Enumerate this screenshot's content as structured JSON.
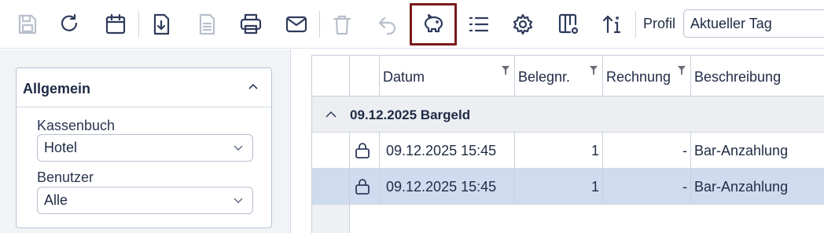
{
  "toolbar": {
    "buttons": [
      {
        "icon": "save-icon",
        "disabled": true
      },
      {
        "icon": "refresh-icon",
        "disabled": false
      },
      {
        "icon": "calendar-icon",
        "disabled": false
      },
      {
        "icon": "export-download-icon",
        "disabled": false
      },
      {
        "icon": "document-icon",
        "disabled": true
      },
      {
        "icon": "printer-icon",
        "disabled": false
      },
      {
        "icon": "mail-icon",
        "disabled": false
      },
      {
        "icon": "trash-icon",
        "disabled": true
      },
      {
        "icon": "undo-icon",
        "disabled": true
      },
      {
        "icon": "piggy-bank-icon",
        "disabled": false,
        "active": true
      },
      {
        "icon": "list-icon",
        "disabled": false
      },
      {
        "icon": "gear-icon",
        "disabled": false
      },
      {
        "icon": "column-settings-icon",
        "disabled": false
      },
      {
        "icon": "sort-info-icon",
        "disabled": false
      }
    ],
    "profil_label": "Profil",
    "profil_value": "Aktueller Tag"
  },
  "filters": {
    "title": "Allgemein",
    "kassenbuch_label": "Kassenbuch",
    "kassenbuch_value": "Hotel",
    "benutzer_label": "Benutzer",
    "benutzer_value": "Alle"
  },
  "grid": {
    "columns": [
      "",
      "",
      "Datum",
      "Belegnr.",
      "Rechnung",
      "Beschreibung"
    ],
    "group_label": "09.12.2025 Bargeld",
    "rows": [
      {
        "datum": "09.12.2025 15:45",
        "belegnr": "1",
        "rechnung": "-",
        "beschreibung": "Bar-Anzahlung",
        "locked": true,
        "selected": false
      },
      {
        "datum": "09.12.2025 15:45",
        "belegnr": "1",
        "rechnung": "-",
        "beschreibung": "Bar-Anzahlung",
        "locked": true,
        "selected": true
      }
    ]
  },
  "colors": {
    "accent_active_border": "#7a1a1a",
    "selected_row": "#cfdcef",
    "icon": "#2f3b5c",
    "icon_disabled": "#b9bfcc"
  }
}
